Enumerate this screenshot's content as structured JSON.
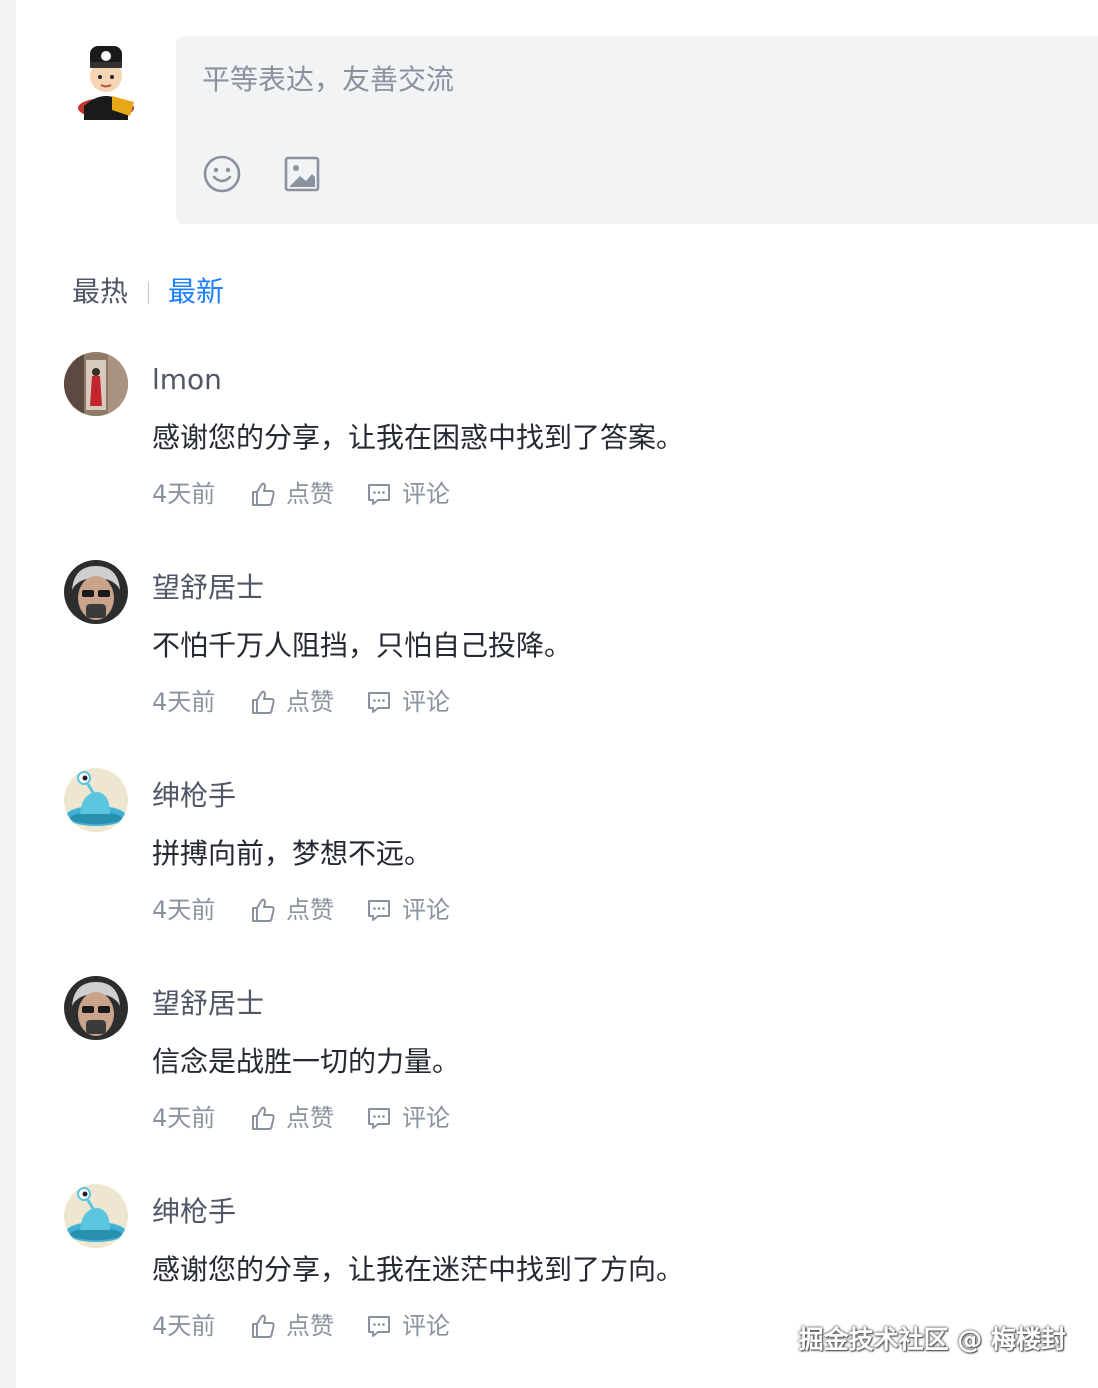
{
  "composer": {
    "placeholder": "平等表达，友善交流",
    "tools": [
      "emoji-icon",
      "image-icon"
    ]
  },
  "sort": {
    "hot_label": "最热",
    "new_label": "最新",
    "active": "最新",
    "active_color": "#1e80ff"
  },
  "comments": [
    {
      "user": "lmon",
      "text": "感谢您的分享，让我在困惑中找到了答案。",
      "time": "4天前",
      "like_label": "点赞",
      "reply_label": "评论"
    },
    {
      "user": "望舒居士",
      "text": "不怕千万人阻挡，只怕自己投降。",
      "time": "4天前",
      "like_label": "点赞",
      "reply_label": "评论"
    },
    {
      "user": "绅枪手",
      "text": "拼搏向前，梦想不远。",
      "time": "4天前",
      "like_label": "点赞",
      "reply_label": "评论"
    },
    {
      "user": "望舒居士",
      "text": "信念是战胜一切的力量。",
      "time": "4天前",
      "like_label": "点赞",
      "reply_label": "评论"
    },
    {
      "user": "绅枪手",
      "text": "感谢您的分享，让我在迷茫中找到了方向。",
      "time": "4天前",
      "like_label": "点赞",
      "reply_label": "评论"
    }
  ],
  "watermark": "掘金技术社区 @ 梅楼封"
}
